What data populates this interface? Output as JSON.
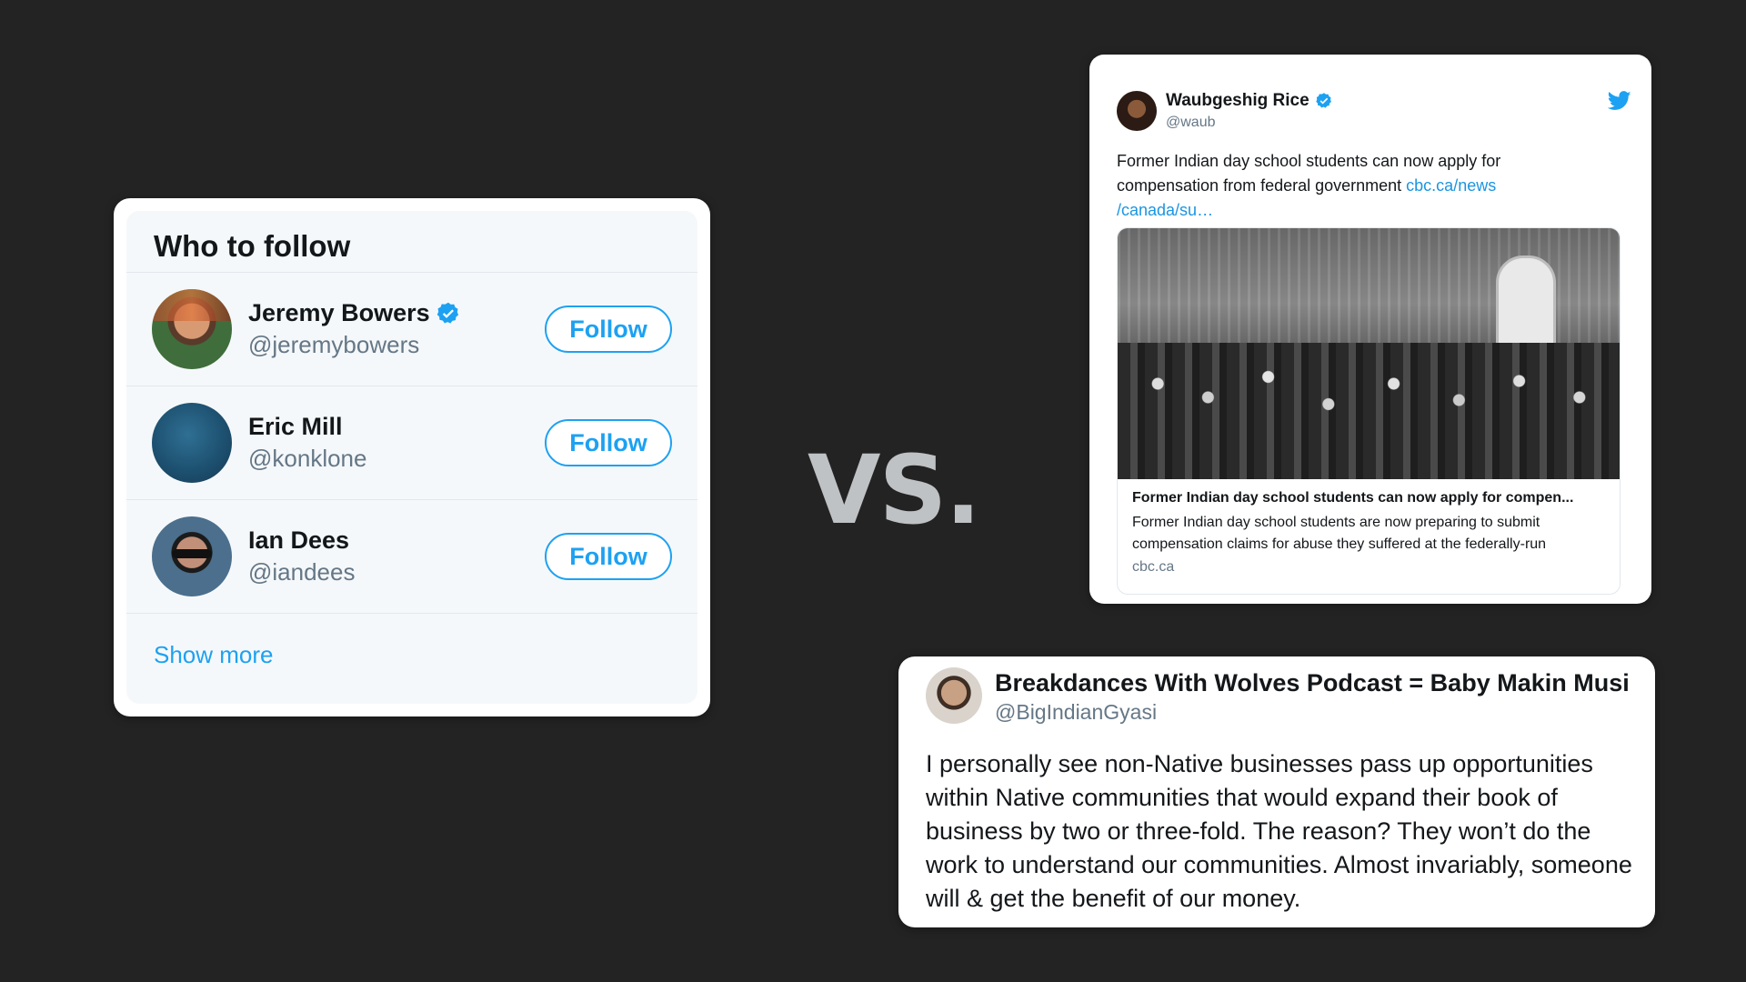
{
  "who_to_follow": {
    "title": "Who to follow",
    "users": [
      {
        "name": "Jeremy Bowers",
        "handle": "@jeremybowers",
        "verified": true,
        "button": "Follow"
      },
      {
        "name": "Eric Mill",
        "handle": "@konklone",
        "verified": false,
        "button": "Follow"
      },
      {
        "name": "Ian Dees",
        "handle": "@iandees",
        "verified": false,
        "button": "Follow"
      }
    ],
    "show_more": "Show more"
  },
  "vs_label": "VS.",
  "tweet": {
    "name": "Waubgeshig Rice",
    "handle": "@waub",
    "text": "Former Indian day school students can now apply for compensation from federal government ",
    "link_line1": "cbc.ca/news",
    "link_line2": "/canada/su…",
    "card": {
      "title": "Former Indian day school students can now apply for compen...",
      "description": "Former Indian day school students are now preparing to submit compensation claims for abuse they suffered at the federally-run",
      "domain": "cbc.ca"
    }
  },
  "quote": {
    "name": "Breakdances With Wolves Podcast = Baby Makin Musi",
    "handle": "@BigIndianGyasi",
    "text": "I personally see non-Native businesses pass up opportunities within Native communities that would expand their book of business by two or three-fold. The reason? They won’t do the work to understand our communities. Almost invariably, someone will & get the benefit of our money."
  },
  "colors": {
    "twitter_blue": "#1da1f2",
    "background": "#232323",
    "vs_color": "#bfc2c4"
  }
}
